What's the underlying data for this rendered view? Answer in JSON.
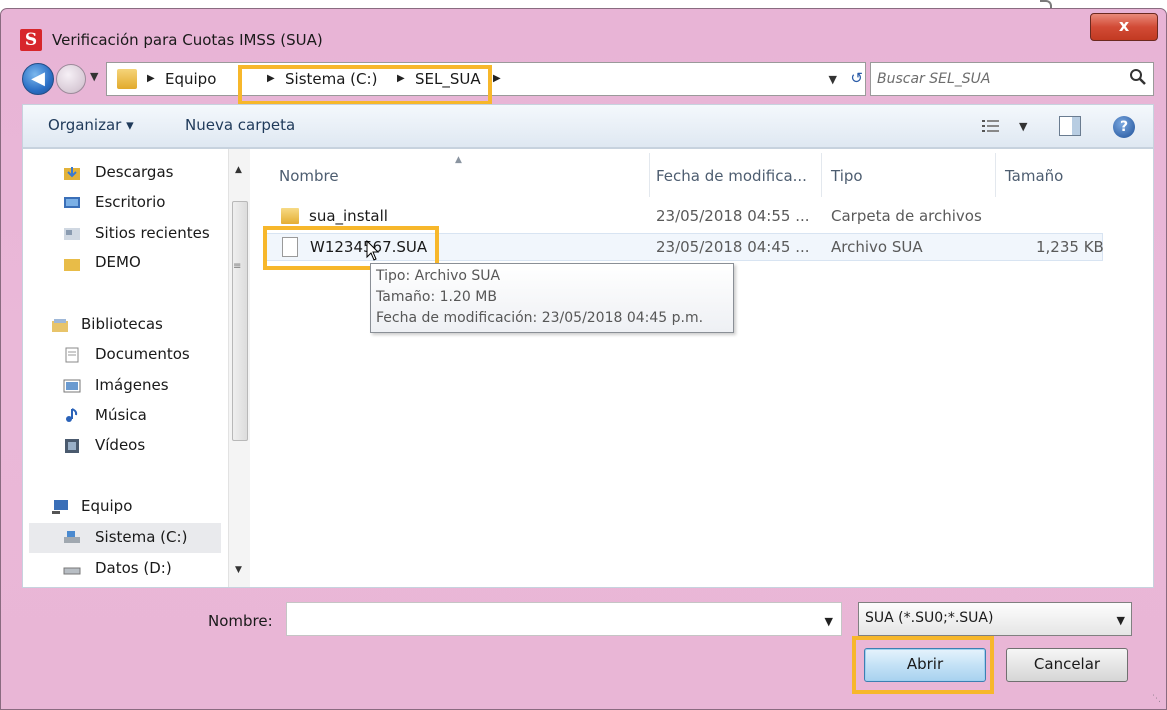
{
  "window": {
    "title": "Verificación para Cuotas IMSS (SUA)",
    "app_icon_letter": "S",
    "close_label": "x"
  },
  "address_bar": {
    "crumbs": [
      "Equipo",
      "Sistema (C:)",
      "SEL_SUA"
    ]
  },
  "search": {
    "placeholder": "Buscar SEL_SUA"
  },
  "toolbar": {
    "organize_label": "Organizar ▾",
    "new_folder_label": "Nueva carpeta",
    "help_label": "?"
  },
  "sidebar": {
    "items": [
      {
        "label": "Descargas",
        "icon": "downloads-icon"
      },
      {
        "label": "Escritorio",
        "icon": "desktop-icon"
      },
      {
        "label": "Sitios recientes",
        "icon": "recent-places-icon"
      },
      {
        "label": "DEMO",
        "icon": "folder-icon"
      },
      {
        "label": "Bibliotecas",
        "icon": "libraries-icon"
      },
      {
        "label": "Documentos",
        "icon": "documents-icon"
      },
      {
        "label": "Imágenes",
        "icon": "pictures-icon"
      },
      {
        "label": "Música",
        "icon": "music-icon"
      },
      {
        "label": "Vídeos",
        "icon": "videos-icon"
      },
      {
        "label": "Equipo",
        "icon": "computer-icon"
      },
      {
        "label": "Sistema (C:)",
        "icon": "drive-icon"
      },
      {
        "label": "Datos (D:)",
        "icon": "drive-icon"
      }
    ],
    "selected": "Sistema (C:)"
  },
  "file_list": {
    "columns": [
      "Nombre",
      "Fecha de modifica...",
      "Tipo",
      "Tamaño"
    ],
    "rows": [
      {
        "name": "sua_install",
        "date": "23/05/2018 04:55 ...",
        "type": "Carpeta de archivos",
        "size": ""
      },
      {
        "name": "W1234567.SUA",
        "date": "23/05/2018 04:45 ...",
        "type": "Archivo SUA",
        "size": "1,235 KB"
      }
    ]
  },
  "tooltip": {
    "line1": "Tipo: Archivo SUA",
    "line2": "Tamaño: 1.20 MB",
    "line3": "Fecha de modificación: 23/05/2018 04:45 p.m."
  },
  "bottom": {
    "name_label": "Nombre:",
    "name_value": "",
    "filter_value": "SUA (*.SU0;*.SUA)",
    "open_label": "Abrir",
    "cancel_label": "Cancelar"
  },
  "colors": {
    "highlight": "#f7b72b",
    "window_frame": "#e8b4d6"
  }
}
